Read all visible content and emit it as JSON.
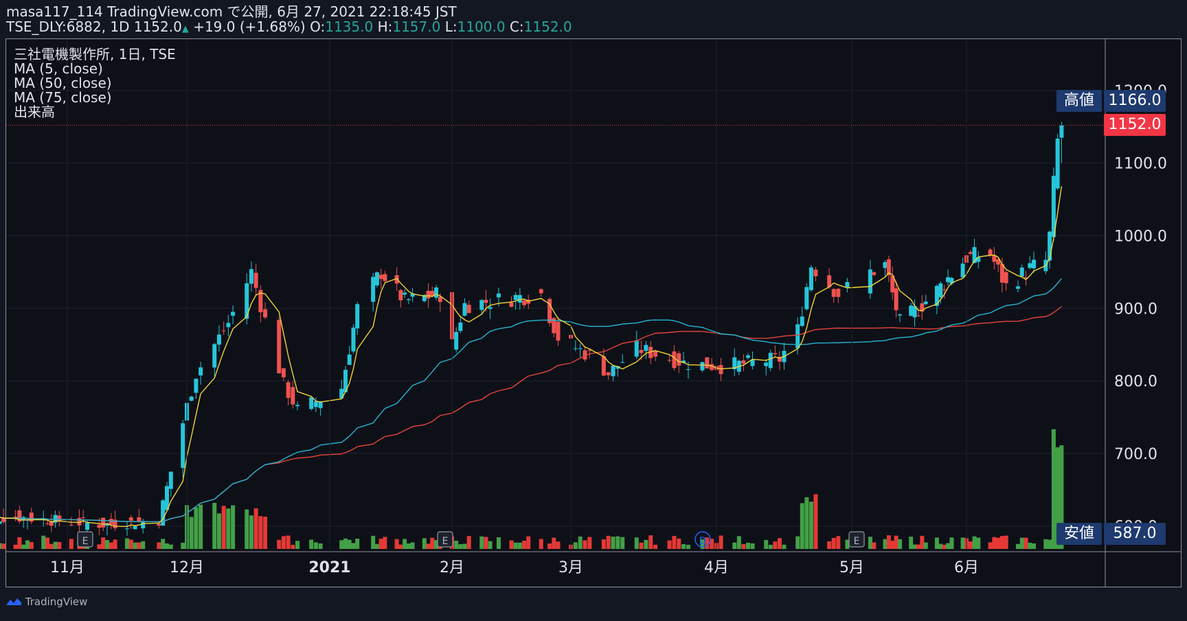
{
  "header": {
    "line1": "masa117_114 TradingView.com で公開, 6月 27, 2021 22:18:45 JST",
    "symbol": "TSE_DLY:6882, 1D",
    "last": "1152.0",
    "change": "+19.0 (+1.68%)",
    "o_label": "O:",
    "o_val": "1135.0",
    "h_label": "H:",
    "h_val": "1157.0",
    "l_label": "L:",
    "l_val": "1100.0",
    "c_label": "C:",
    "c_val": "1152.0"
  },
  "legend": {
    "title": "三社電機製作所, 1日, TSE",
    "ma5": "MA (5, close)",
    "ma50": "MA (50, close)",
    "ma75": "MA (75, close)",
    "volume": "出来高"
  },
  "tags": {
    "high_label": "高値",
    "high_value": "1166.0",
    "last_value": "1152.0",
    "low_label": "安値",
    "low_value": "587.0"
  },
  "footer": {
    "brand": "TradingView"
  },
  "colors": {
    "up": "#26c6da",
    "down": "#ef5350",
    "ma5": "#f2d43a",
    "ma50": "#26b5d2",
    "ma75": "#e8453c",
    "vol_up": "#43a047",
    "vol_down": "#e53935",
    "tag_dark": "#1e3a6e",
    "tag_last": "#f23645"
  },
  "chart_data": {
    "type": "candlestick",
    "y_ticks": [
      "600.0",
      "700.0",
      "800.0",
      "900.0",
      "1000.0",
      "1100.0",
      "1200.0"
    ],
    "ylim": [
      580,
      1210
    ],
    "x_ticks": [
      "11月",
      "12月",
      "2021",
      "2月",
      "3月",
      "4月",
      "5月",
      "6月"
    ],
    "event_markers": [
      "E",
      "E",
      "D",
      "E"
    ],
    "price_anchors": [
      {
        "date": "2020-10-20",
        "close": 612
      },
      {
        "date": "2020-11-10",
        "close": 602
      },
      {
        "date": "2020-11-24",
        "close": 608
      },
      {
        "date": "2020-12-03",
        "close": 810
      },
      {
        "date": "2020-12-10",
        "close": 880
      },
      {
        "date": "2020-12-15",
        "close": 950
      },
      {
        "date": "2020-12-22",
        "close": 795
      },
      {
        "date": "2020-12-25",
        "close": 760
      },
      {
        "date": "2021-01-04",
        "close": 790
      },
      {
        "date": "2021-01-08",
        "close": 900
      },
      {
        "date": "2021-01-14",
        "close": 950
      },
      {
        "date": "2021-01-20",
        "close": 910
      },
      {
        "date": "2021-01-29",
        "close": 920
      },
      {
        "date": "2021-02-01",
        "close": 850
      },
      {
        "date": "2021-02-04",
        "close": 905
      },
      {
        "date": "2021-02-22",
        "close": 920
      },
      {
        "date": "2021-02-26",
        "close": 860
      },
      {
        "date": "2021-03-05",
        "close": 835
      },
      {
        "date": "2021-03-09",
        "close": 810
      },
      {
        "date": "2021-03-15",
        "close": 845
      },
      {
        "date": "2021-03-25",
        "close": 825
      },
      {
        "date": "2021-04-02",
        "close": 820
      },
      {
        "date": "2021-04-15",
        "close": 830
      },
      {
        "date": "2021-04-19",
        "close": 870
      },
      {
        "date": "2021-04-22",
        "close": 960
      },
      {
        "date": "2021-04-28",
        "close": 920
      },
      {
        "date": "2021-05-06",
        "close": 950
      },
      {
        "date": "2021-05-10",
        "close": 960
      },
      {
        "date": "2021-05-14",
        "close": 880
      },
      {
        "date": "2021-05-19",
        "close": 900
      },
      {
        "date": "2021-05-25",
        "close": 930
      },
      {
        "date": "2021-06-01",
        "close": 970
      },
      {
        "date": "2021-06-07",
        "close": 975
      },
      {
        "date": "2021-06-11",
        "close": 930
      },
      {
        "date": "2021-06-17",
        "close": 955
      },
      {
        "date": "2021-06-21",
        "close": 965
      },
      {
        "date": "2021-06-22",
        "close": 1000
      },
      {
        "date": "2021-06-23",
        "close": 1070
      },
      {
        "date": "2021-06-24",
        "close": 1130
      },
      {
        "date": "2021-06-25",
        "close": 1152
      }
    ],
    "ma50_end": 940,
    "ma75_end": 902,
    "last_close": 1152,
    "high": 1166,
    "low": 587
  }
}
